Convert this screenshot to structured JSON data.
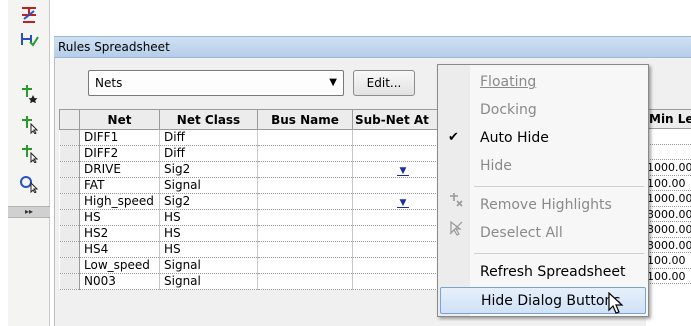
{
  "toolbar": {
    "tools": [
      {
        "icon": "route-icon"
      },
      {
        "icon": "rules-check-icon"
      },
      {
        "icon": "net-star-icon"
      },
      {
        "icon": "net-select-icon"
      },
      {
        "icon": "net-select-2-icon"
      },
      {
        "icon": "probe-icon"
      }
    ]
  },
  "panel": {
    "title": "Rules Spreadsheet",
    "selector_value": "Nets",
    "edit_label": "Edit..."
  },
  "table": {
    "columns": [
      "Net",
      "Net Class",
      "Bus Name",
      "Sub-Net At"
    ],
    "rows": [
      {
        "net": "DIFF1",
        "net_class": "Diff",
        "bus_name": "",
        "subnet_dropdown": false
      },
      {
        "net": "DIFF2",
        "net_class": "Diff",
        "bus_name": "",
        "subnet_dropdown": false
      },
      {
        "net": "DRIVE",
        "net_class": "Sig2",
        "bus_name": "",
        "subnet_dropdown": true
      },
      {
        "net": "FAT",
        "net_class": "Signal",
        "bus_name": "",
        "subnet_dropdown": false
      },
      {
        "net": "High_speed",
        "net_class": "Sig2",
        "bus_name": "",
        "subnet_dropdown": true
      },
      {
        "net": "HS",
        "net_class": "HS",
        "bus_name": "",
        "subnet_dropdown": false
      },
      {
        "net": "HS2",
        "net_class": "HS",
        "bus_name": "",
        "subnet_dropdown": false
      },
      {
        "net": "HS4",
        "net_class": "HS",
        "bus_name": "",
        "subnet_dropdown": false
      },
      {
        "net": "Low_speed",
        "net_class": "Signal",
        "bus_name": "",
        "subnet_dropdown": false
      },
      {
        "net": "N003",
        "net_class": "Signal",
        "bus_name": "",
        "subnet_dropdown": false
      }
    ],
    "min_length_header": "Min Le",
    "min_length_values": [
      "",
      "",
      "1000.00",
      "100.00",
      "1000.00",
      "3000.00",
      "3000.00",
      "3000.00",
      "100.00",
      "100.00"
    ]
  },
  "context_menu": {
    "items": [
      {
        "label": "Floating",
        "enabled": false,
        "checked": false,
        "icon": ""
      },
      {
        "label": "Docking",
        "enabled": false,
        "checked": false,
        "icon": ""
      },
      {
        "label": "Auto Hide",
        "enabled": true,
        "checked": true,
        "icon": "checkmark-icon"
      },
      {
        "label": "Hide",
        "enabled": false,
        "checked": false,
        "icon": ""
      },
      {
        "label": "Remove Highlights",
        "enabled": false,
        "checked": false,
        "icon": "remove-highlights-icon"
      },
      {
        "label": "Deselect All",
        "enabled": false,
        "checked": false,
        "icon": "deselect-all-icon"
      },
      {
        "label": "Refresh Spreadsheet",
        "enabled": true,
        "checked": false,
        "icon": ""
      },
      {
        "label": "Hide Dialog Buttons",
        "enabled": true,
        "checked": false,
        "icon": "",
        "highlighted": true
      }
    ]
  },
  "colors": {
    "title_bar": "#c3d7ee",
    "menu_highlight": "#cfe2f7",
    "dropdown_arrow": "#1c2f9c"
  }
}
